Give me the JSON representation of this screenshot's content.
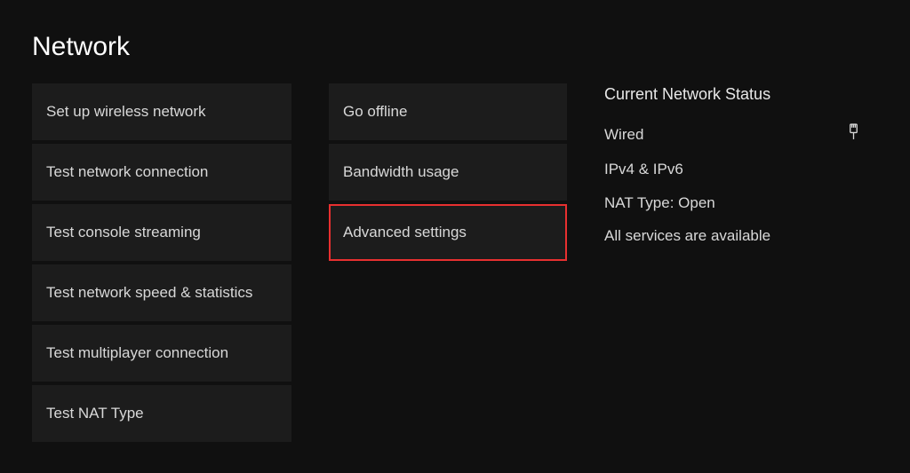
{
  "title": "Network",
  "columnLeft": [
    {
      "label": "Set up wireless network",
      "highlighted": false
    },
    {
      "label": "Test network connection",
      "highlighted": false
    },
    {
      "label": "Test console streaming",
      "highlighted": false
    },
    {
      "label": "Test network speed & statistics",
      "highlighted": false
    },
    {
      "label": "Test multiplayer connection",
      "highlighted": false
    },
    {
      "label": "Test NAT Type",
      "highlighted": false
    }
  ],
  "columnMid": [
    {
      "label": "Go offline",
      "highlighted": false
    },
    {
      "label": "Bandwidth usage",
      "highlighted": false
    },
    {
      "label": "Advanced settings",
      "highlighted": true
    }
  ],
  "status": {
    "heading": "Current Network Status",
    "connectionType": "Wired",
    "lines": [
      "IPv4 & IPv6",
      "NAT Type: Open",
      "All services are available"
    ]
  }
}
